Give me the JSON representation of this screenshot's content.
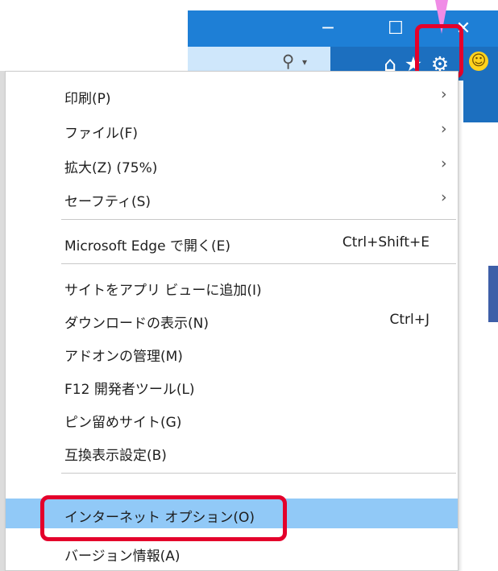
{
  "browser": {
    "window_controls": {
      "minimize_icon": "─",
      "maximize_icon": "☐",
      "close_icon": "✕"
    },
    "toolbar": {
      "search_icon": "⚲",
      "dropdown_icon": "▾",
      "home_icon": "⌂",
      "favorites_icon": "★",
      "tools_icon": "⚙",
      "feedback_icon": "☺"
    }
  },
  "menu": {
    "items": [
      {
        "label": "印刷(P)",
        "shortcut": "",
        "submenu": true
      },
      {
        "label": "ファイル(F)",
        "shortcut": "",
        "submenu": true
      },
      {
        "label": "拡大(Z) (75%)",
        "shortcut": "",
        "submenu": true
      },
      {
        "label": "セーフティ(S)",
        "shortcut": "",
        "submenu": true
      },
      {
        "label": "Microsoft Edge で開く(E)",
        "shortcut": "Ctrl+Shift+E",
        "submenu": false
      },
      {
        "label": "サイトをアプリ ビューに追加(I)",
        "shortcut": "",
        "submenu": false
      },
      {
        "label": "ダウンロードの表示(N)",
        "shortcut": "Ctrl+J",
        "submenu": false
      },
      {
        "label": "アドオンの管理(M)",
        "shortcut": "",
        "submenu": false
      },
      {
        "label": "F12 開発者ツール(L)",
        "shortcut": "",
        "submenu": false
      },
      {
        "label": "ピン留めサイト(G)",
        "shortcut": "",
        "submenu": false
      },
      {
        "label": "互換表示設定(B)",
        "shortcut": "",
        "submenu": false
      },
      {
        "label": "インターネット オプション(O)",
        "shortcut": "",
        "submenu": false,
        "highlighted": true
      },
      {
        "label": "バージョン情報(A)",
        "shortcut": "",
        "submenu": false
      }
    ],
    "submenu_arrow": "›"
  },
  "colors": {
    "titlebar": "#1e7fd6",
    "highlight": "#91c9f7",
    "annotation_red": "#e4002b",
    "annotation_arrow": "#f08ce6"
  }
}
